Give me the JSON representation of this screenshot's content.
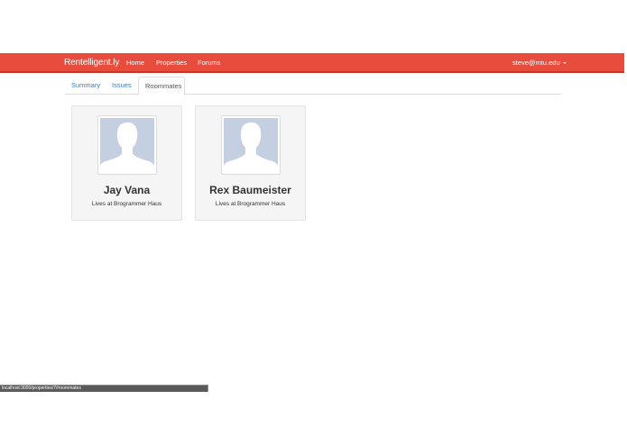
{
  "navbar": {
    "brand": "Rentelligent.ly",
    "links": [
      "Home",
      "Properties",
      "Forums"
    ],
    "user": "steve@mtu.edu",
    "color": "#e74c3c"
  },
  "tabs": [
    "Summary",
    "Issues",
    "Roommates"
  ],
  "active_tab": "Roommates",
  "roommates": [
    {
      "name": "Jay Vana",
      "subtitle": "Lives at Brogrammer Haus",
      "avatar": "default-profile-icon"
    },
    {
      "name": "Rex Baumeister",
      "subtitle": "Lives at Brogrammer Haus",
      "avatar": "default-profile-icon"
    }
  ],
  "status_bar": {
    "url": "localhost:3000/properties/7#roommates"
  }
}
